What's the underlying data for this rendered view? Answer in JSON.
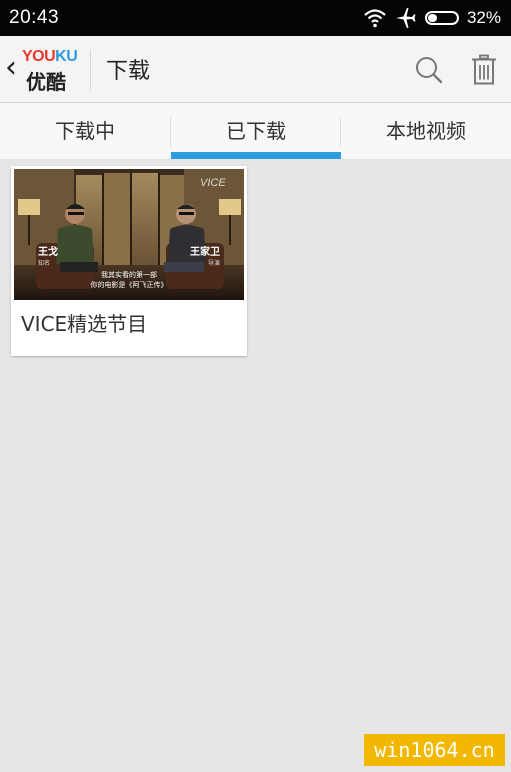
{
  "status_bar": {
    "time": "20:43",
    "battery_percent": "32%",
    "battery_level": 0.32,
    "icons": [
      "wifi-icon",
      "airplane-mode-icon",
      "battery-icon"
    ]
  },
  "header": {
    "back_glyph": "‹",
    "logo_en_red": "YOU",
    "logo_en_blue": "KU",
    "logo_cn": "优酷",
    "title": "下载",
    "actions": [
      "search-icon",
      "trash-icon"
    ]
  },
  "tabs": {
    "items": [
      {
        "label": "下载中"
      },
      {
        "label": "已下载"
      },
      {
        "label": "本地视频"
      }
    ],
    "selected_index": 1,
    "accent_color": "#2d9de0"
  },
  "videos": [
    {
      "title": "VICE精选节目",
      "thumbnail": {
        "corner_logo": "VICE",
        "name_left": "王戈",
        "role_left": "知名",
        "name_right": "王家卫",
        "role_right": "导演",
        "subtitle_line1": "我其实看的第一部",
        "subtitle_line2": "你的电影是《阿飞正传》"
      }
    }
  ],
  "watermark": "win1064.cn"
}
